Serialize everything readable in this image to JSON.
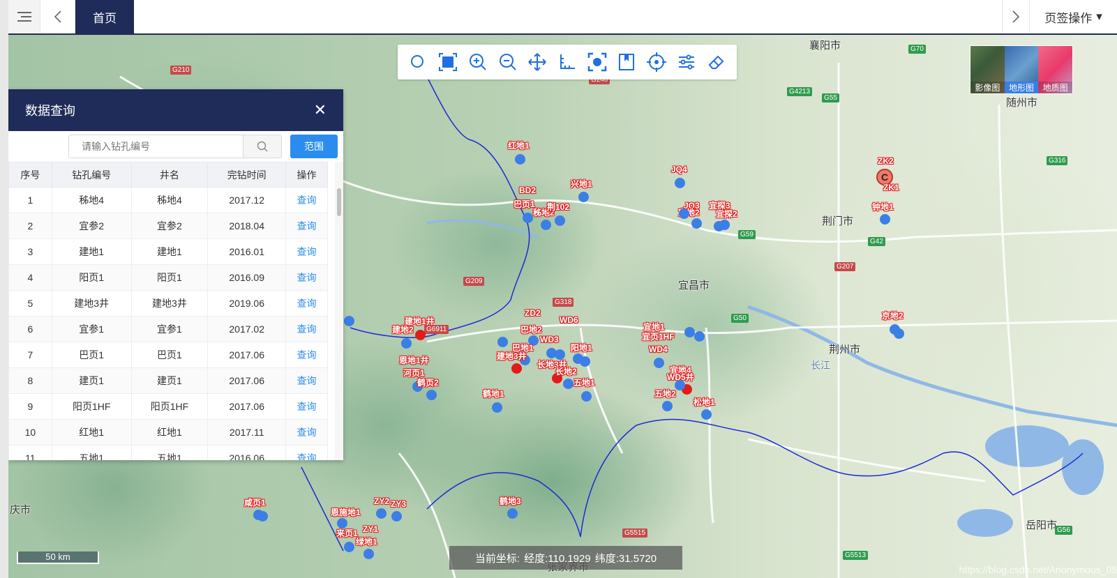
{
  "topbar": {
    "active_tab": "首页",
    "tab_ops_label": "页签操作"
  },
  "toolbar": {
    "icons": [
      "search-icon",
      "full-extent-icon",
      "zoom-in-icon",
      "zoom-out-icon",
      "pan-icon",
      "measure-icon",
      "locate-target-icon",
      "bookmark-icon",
      "crosshair-icon",
      "settings-sliders-icon",
      "eraser-icon"
    ]
  },
  "basemaps": [
    "影像图",
    "地形图",
    "地质图"
  ],
  "panel": {
    "title": "数据查询",
    "search_placeholder": "请输入钻孔编号",
    "range_label": "范围",
    "columns": [
      "序号",
      "钻孔编号",
      "井名",
      "完钻时间",
      "操作"
    ],
    "rows": [
      {
        "no": "1",
        "code": "秭地4",
        "name": "秭地4",
        "time": "2017.12",
        "op": "查询"
      },
      {
        "no": "2",
        "code": "宜参2",
        "name": "宜参2",
        "time": "2018.04",
        "op": "查询"
      },
      {
        "no": "3",
        "code": "建地1",
        "name": "建地1",
        "time": "2016.01",
        "op": "查询"
      },
      {
        "no": "4",
        "code": "阳页1",
        "name": "阳页1",
        "time": "2016.09",
        "op": "查询"
      },
      {
        "no": "5",
        "code": "建地3井",
        "name": "建地3井",
        "time": "2019.06",
        "op": "查询"
      },
      {
        "no": "6",
        "code": "宜参1",
        "name": "宜参1",
        "time": "2017.02",
        "op": "查询"
      },
      {
        "no": "7",
        "code": "巴页1",
        "name": "巴页1",
        "time": "2017.06",
        "op": "查询"
      },
      {
        "no": "8",
        "code": "建页1",
        "name": "建页1",
        "time": "2017.06",
        "op": "查询"
      },
      {
        "no": "9",
        "code": "阳页1HF",
        "name": "阳页1HF",
        "time": "2017.06",
        "op": "查询"
      },
      {
        "no": "10",
        "code": "红地1",
        "name": "红地1",
        "time": "2017.11",
        "op": "查询"
      },
      {
        "no": "11",
        "code": "五地1",
        "name": "五地1",
        "time": "2016.06",
        "op": "查询"
      }
    ]
  },
  "map": {
    "cities": [
      "襄阳市",
      "随州市",
      "荆门市",
      "宜昌市",
      "荆州市",
      "岳阳市",
      "庆市",
      "长江",
      "张家界市"
    ],
    "roads": [
      "G210",
      "G70",
      "G4213",
      "G55",
      "G316",
      "G209",
      "G318",
      "G42",
      "G207",
      "G50",
      "G59",
      "G6911",
      "G56",
      "G5513",
      "G5515",
      "G240"
    ],
    "wells": [
      "红地1",
      "兴地1",
      "BD2",
      "巴页1",
      "秭地2",
      "荆102",
      "JQ4",
      "JQ3",
      "宜地2",
      "宜探3",
      "宜探2",
      "ZK2",
      "ZK1",
      "钟地1",
      "京地2",
      "建地1井",
      "建地2",
      "恩地1井",
      "河页1",
      "鹤页2",
      "鹤地1",
      "宜地1",
      "宜页1HF",
      "WD4",
      "宜地4",
      "WD5井",
      "五地2",
      "松地1",
      "巴地2",
      "巴地1",
      "建地3井",
      "长地3井",
      "长地2",
      "五地1",
      "咸页1",
      "恩施地1",
      "ZY2",
      "ZY3",
      "ZY1",
      "来页1",
      "绿地1",
      "鹤地3",
      "ZD2",
      "WD6",
      "WD3",
      "阳地1"
    ],
    "marker_letter": "C"
  },
  "scale_label": "50 km",
  "coord": {
    "label": "当前坐标:",
    "lon": "经度:110.1929",
    "lat": "纬度:31.5720"
  },
  "watermark": "https://blog.csdn.net/Anonymous_05"
}
